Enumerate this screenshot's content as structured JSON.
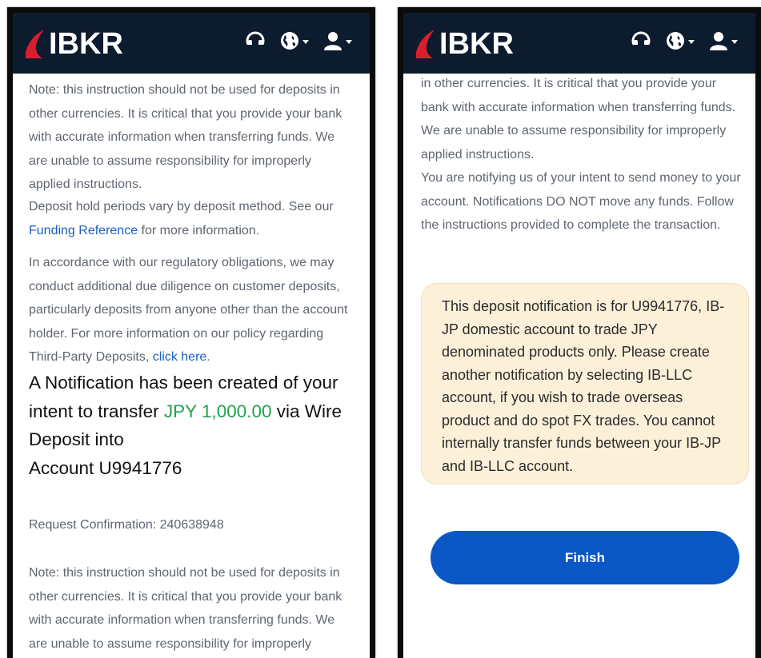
{
  "brand": {
    "logo_text": "IBKR",
    "colors": {
      "header_bg": "#0d1b2e",
      "logo_red": "#d81e2c",
      "link_blue": "#1b5fc1",
      "amount_green": "#20a24e",
      "button_blue": "#0a57c5",
      "notice_bg": "#fcf0d9"
    }
  },
  "header_icons": [
    "support-headset-icon",
    "globe-icon",
    "user-icon"
  ],
  "left": {
    "note_1": "Note: this instruction should not be used for deposits in other currencies. It is critical that you provide your bank with accurate information when transferring funds. We are unable to assume responsibility for improperly applied instructions.",
    "hold_prefix": "Deposit hold periods vary by deposit method. See our ",
    "hold_link": "Funding Reference",
    "hold_suffix": " for more information.",
    "regulatory_prefix": "In accordance with our regulatory obligations, we may conduct additional due diligence on customer deposits, particularly deposits from anyone other than the account holder. For more information on our policy regarding Third-Party Deposits, ",
    "regulatory_link": "click here",
    "regulatory_suffix": ".",
    "heading_prefix": "A Notification has been created of your intent to transfer ",
    "heading_amount": "JPY 1,000.00",
    "heading_mid": " via Wire Deposit into",
    "heading_account": "Account U9941776",
    "confirmation": "Request Confirmation: 240638948",
    "note_2": "Note: this instruction should not be used for deposits in other currencies. It is critical that you provide your bank with accurate information when transferring funds. We are unable to assume responsibility for improperly applied instructions."
  },
  "right": {
    "note_tail": "in other currencies. It is critical that you provide your bank with accurate information when transferring funds. We are unable to assume responsibility for improperly applied instructions.",
    "intent_text": "You are notifying us of your intent to send money to your account. Notifications DO NOT move any funds. Follow the instructions provided to complete the transaction.",
    "notice": "This deposit notification is for U9941776, IB-JP domestic account to trade JPY denominated products only. Please create another notification by selecting IB-LLC account, if you wish to trade overseas product and do spot FX trades. You cannot internally transfer funds between your IB-JP and IB-LLC account.",
    "finish_label": "Finish"
  }
}
